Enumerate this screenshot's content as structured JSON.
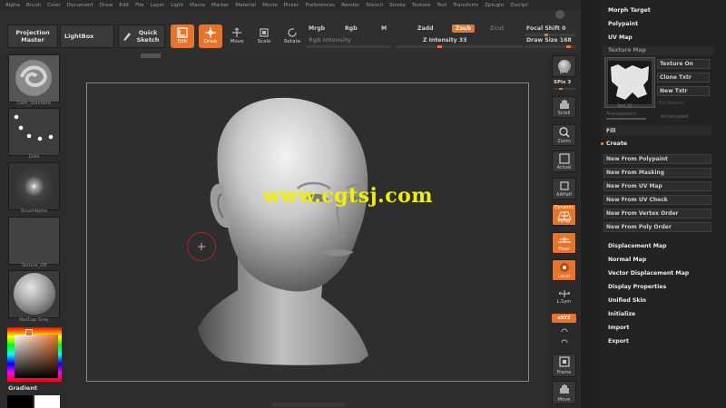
{
  "menu": [
    "Alpha",
    "Brush",
    "Color",
    "Document",
    "Draw",
    "Edit",
    "File",
    "Layer",
    "Light",
    "Macro",
    "Marker",
    "Material",
    "Movie",
    "Picker",
    "Preferences",
    "Render",
    "Stencil",
    "Stroke",
    "Texture",
    "Tool",
    "Transform",
    "Zplugin",
    "Zscript"
  ],
  "toolbar": {
    "projection_master": "Projection Master",
    "lightbox": "LightBox",
    "quick_sketch": "Quick Sketch",
    "edit": "Edit",
    "draw": "Draw",
    "move": "Move",
    "scale": "Scale",
    "rotate": "Rotate",
    "mrgb": "Mrgb",
    "rgb": "Rgb",
    "m": "M",
    "zadd": "Zadd",
    "zsub": "Zsub",
    "zcut": "Zcut",
    "rgb_intensity": "Rgb Intensity",
    "z_intensity": "Z Intensity 33",
    "focal_shift": "Focal Shift 0",
    "draw_size": "Draw Size 168",
    "z_intensity_level": 0.33
  },
  "left_shelf": {
    "brush": "Dam_Standard",
    "stroke": "Dots",
    "alpha": "BrushAlpha",
    "texture": "Texture_Off",
    "material": "MatCap Gray",
    "gradient": "Gradient"
  },
  "right_shelf": {
    "bpr": "BPR",
    "spix": "SPix 3",
    "scroll": "Scroll",
    "zoom": "Zoom",
    "actual": "Actual",
    "aahalf": "AAHalf",
    "dynamic": "Dynamic",
    "persp": "Persp",
    "floor": "Floor",
    "local": "Local",
    "lsym": "L.Sym",
    "xyz": "xXYZ",
    "frame": "Frame",
    "move": "Move"
  },
  "right_panel": {
    "morph_target": "Morph Target",
    "polypaint": "Polypaint",
    "uv_map": "UV Map",
    "texture_map": "Texture Map",
    "texture_on": "Texture On",
    "clone_txtr": "Clone Txtr",
    "new_txtr": "New Txtr",
    "fix_seams": "Fix Seams",
    "thumb_caption": "Text_01",
    "transparent": "Transparent",
    "antialiased": "Antialiased",
    "fill": "Fill",
    "create": "Create",
    "create_buttons": [
      "New From Polypaint",
      "New From Masking",
      "New From UV Map",
      "New From UV Check",
      "New From Vertex Order",
      "New From Poly Order"
    ],
    "displacement_map": "Displacement Map",
    "normal_map": "Normal Map",
    "vector_displacement_map": "Vector Displacement Map",
    "display_properties": "Display Properties",
    "unified_skin": "Unified Skin",
    "initialize": "Initialize",
    "import": "Import",
    "export": "Export"
  },
  "watermark": "www.cgtsj.com",
  "colors": {
    "accent": "#e8742a",
    "watermark": "#f2f000"
  }
}
